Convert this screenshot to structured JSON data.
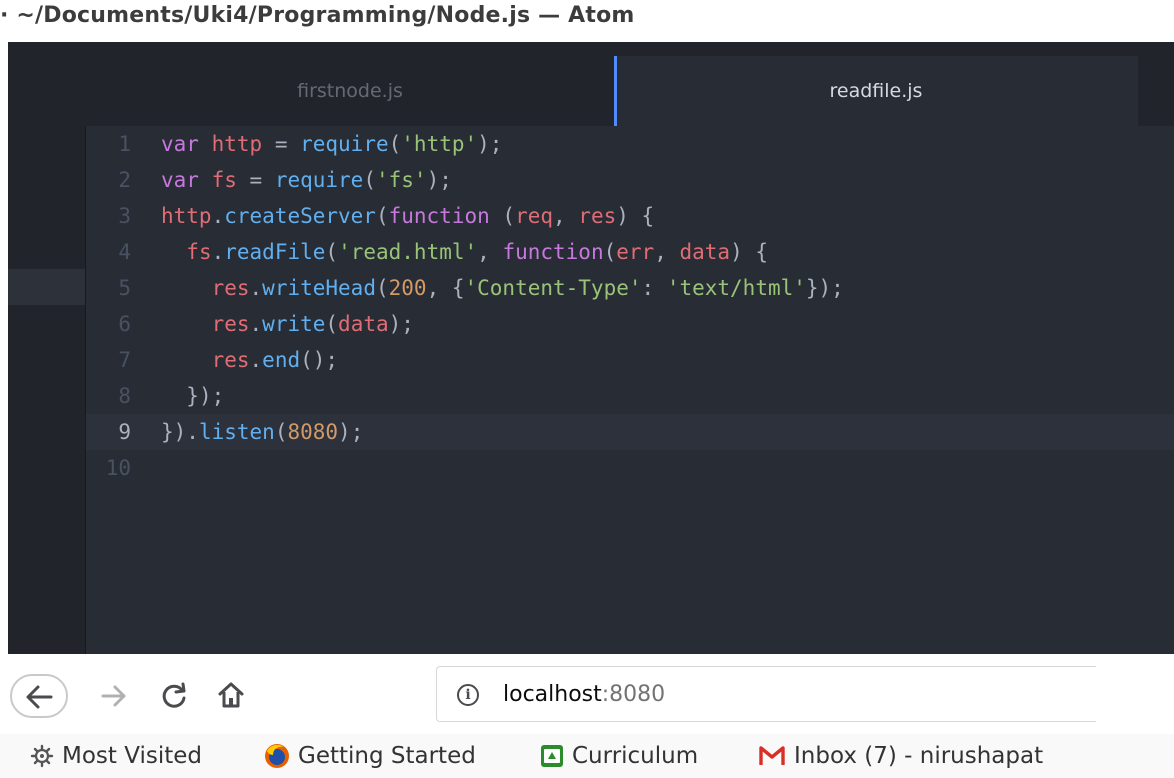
{
  "window": {
    "title": "· ~/Documents/Uki4/Programming/Node.js — Atom"
  },
  "editor": {
    "tabs": [
      {
        "label": "firstnode.js",
        "active": false
      },
      {
        "label": "readfile.js",
        "active": true
      }
    ],
    "current_line": 9,
    "lines": [
      {
        "number": "1",
        "tokens": [
          {
            "t": "var",
            "k": "keyword"
          },
          {
            "t": " ",
            "k": "plain"
          },
          {
            "t": "http",
            "k": "variable"
          },
          {
            "t": " = ",
            "k": "plain"
          },
          {
            "t": "require",
            "k": "function"
          },
          {
            "t": "(",
            "k": "punct"
          },
          {
            "t": "'http'",
            "k": "string"
          },
          {
            "t": ");",
            "k": "punct"
          }
        ]
      },
      {
        "number": "2",
        "tokens": [
          {
            "t": "var",
            "k": "keyword"
          },
          {
            "t": " ",
            "k": "plain"
          },
          {
            "t": "fs",
            "k": "variable"
          },
          {
            "t": " = ",
            "k": "plain"
          },
          {
            "t": "require",
            "k": "function"
          },
          {
            "t": "(",
            "k": "punct"
          },
          {
            "t": "'fs'",
            "k": "string"
          },
          {
            "t": ");",
            "k": "punct"
          }
        ]
      },
      {
        "number": "3",
        "tokens": [
          {
            "t": "http",
            "k": "variable"
          },
          {
            "t": ".",
            "k": "punct"
          },
          {
            "t": "createServer",
            "k": "function"
          },
          {
            "t": "(",
            "k": "punct"
          },
          {
            "t": "function",
            "k": "keyword"
          },
          {
            "t": " (",
            "k": "punct"
          },
          {
            "t": "req",
            "k": "variable"
          },
          {
            "t": ", ",
            "k": "punct"
          },
          {
            "t": "res",
            "k": "variable"
          },
          {
            "t": ") {",
            "k": "punct"
          }
        ]
      },
      {
        "number": "4",
        "tokens": [
          {
            "t": "  ",
            "k": "plain"
          },
          {
            "t": "fs",
            "k": "variable"
          },
          {
            "t": ".",
            "k": "punct"
          },
          {
            "t": "readFile",
            "k": "function"
          },
          {
            "t": "(",
            "k": "punct"
          },
          {
            "t": "'read.html'",
            "k": "string"
          },
          {
            "t": ", ",
            "k": "punct"
          },
          {
            "t": "function",
            "k": "keyword"
          },
          {
            "t": "(",
            "k": "punct"
          },
          {
            "t": "err",
            "k": "variable"
          },
          {
            "t": ", ",
            "k": "punct"
          },
          {
            "t": "data",
            "k": "variable"
          },
          {
            "t": ") {",
            "k": "punct"
          }
        ]
      },
      {
        "number": "5",
        "tokens": [
          {
            "t": "    ",
            "k": "plain"
          },
          {
            "t": "res",
            "k": "variable"
          },
          {
            "t": ".",
            "k": "punct"
          },
          {
            "t": "writeHead",
            "k": "function"
          },
          {
            "t": "(",
            "k": "punct"
          },
          {
            "t": "200",
            "k": "number"
          },
          {
            "t": ", {",
            "k": "punct"
          },
          {
            "t": "'Content-Type'",
            "k": "string"
          },
          {
            "t": ": ",
            "k": "punct"
          },
          {
            "t": "'text/html'",
            "k": "string"
          },
          {
            "t": "});",
            "k": "punct"
          }
        ]
      },
      {
        "number": "6",
        "tokens": [
          {
            "t": "    ",
            "k": "plain"
          },
          {
            "t": "res",
            "k": "variable"
          },
          {
            "t": ".",
            "k": "punct"
          },
          {
            "t": "write",
            "k": "function"
          },
          {
            "t": "(",
            "k": "punct"
          },
          {
            "t": "data",
            "k": "variable"
          },
          {
            "t": ");",
            "k": "punct"
          }
        ]
      },
      {
        "number": "7",
        "tokens": [
          {
            "t": "    ",
            "k": "plain"
          },
          {
            "t": "res",
            "k": "variable"
          },
          {
            "t": ".",
            "k": "punct"
          },
          {
            "t": "end",
            "k": "function"
          },
          {
            "t": "();",
            "k": "punct"
          }
        ]
      },
      {
        "number": "8",
        "tokens": [
          {
            "t": "  ",
            "k": "plain"
          },
          {
            "t": "});",
            "k": "punct"
          }
        ]
      },
      {
        "number": "9",
        "tokens": [
          {
            "t": "})",
            "k": "punct"
          },
          {
            "t": ".",
            "k": "punct"
          },
          {
            "t": "listen",
            "k": "function"
          },
          {
            "t": "(",
            "k": "punct"
          },
          {
            "t": "8080",
            "k": "number"
          },
          {
            "t": ");",
            "k": "punct"
          }
        ]
      },
      {
        "number": "10",
        "tokens": []
      }
    ]
  },
  "browser": {
    "nav": {
      "back_icon": "back-arrow-icon",
      "forward_icon": "forward-arrow-icon",
      "reload_icon": "reload-icon",
      "home_icon": "home-icon"
    },
    "url": {
      "host": "localhost",
      "port": ":8080",
      "info_icon": "info-icon",
      "info_glyph": "i"
    },
    "bookmarks": [
      {
        "label": "Most Visited",
        "icon": "gear-icon"
      },
      {
        "label": "Getting Started",
        "icon": "firefox-icon"
      },
      {
        "label": "Curriculum",
        "icon": "curriculum-icon"
      },
      {
        "label": "Inbox (7) - nirushapat",
        "icon": "gmail-icon"
      }
    ]
  },
  "colors": {
    "editor_bg": "#282c34",
    "tabbar_bg": "#21252b",
    "accent": "#528bff",
    "keyword": "#c678dd",
    "variable": "#e06c75",
    "function": "#61afef",
    "string": "#98c379",
    "number": "#d19a66"
  }
}
